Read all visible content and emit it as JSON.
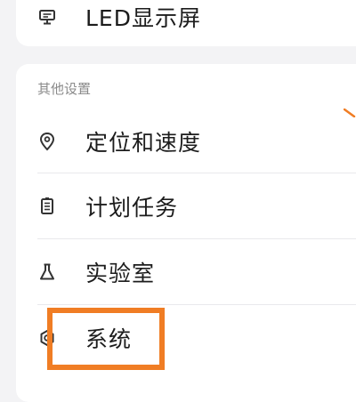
{
  "top_item": {
    "label": "LED显示屏",
    "icon": "monitor-icon"
  },
  "section": {
    "title": "其他设置",
    "items": [
      {
        "label": "定位和速度",
        "icon": "location-pin-icon"
      },
      {
        "label": "计划任务",
        "icon": "clipboard-icon"
      },
      {
        "label": "实验室",
        "icon": "flask-icon"
      },
      {
        "label": "系统",
        "icon": "system-gear-icon"
      }
    ]
  },
  "colors": {
    "highlight": "#f07d24",
    "background": "#f3f3f5",
    "card": "#ffffff"
  }
}
